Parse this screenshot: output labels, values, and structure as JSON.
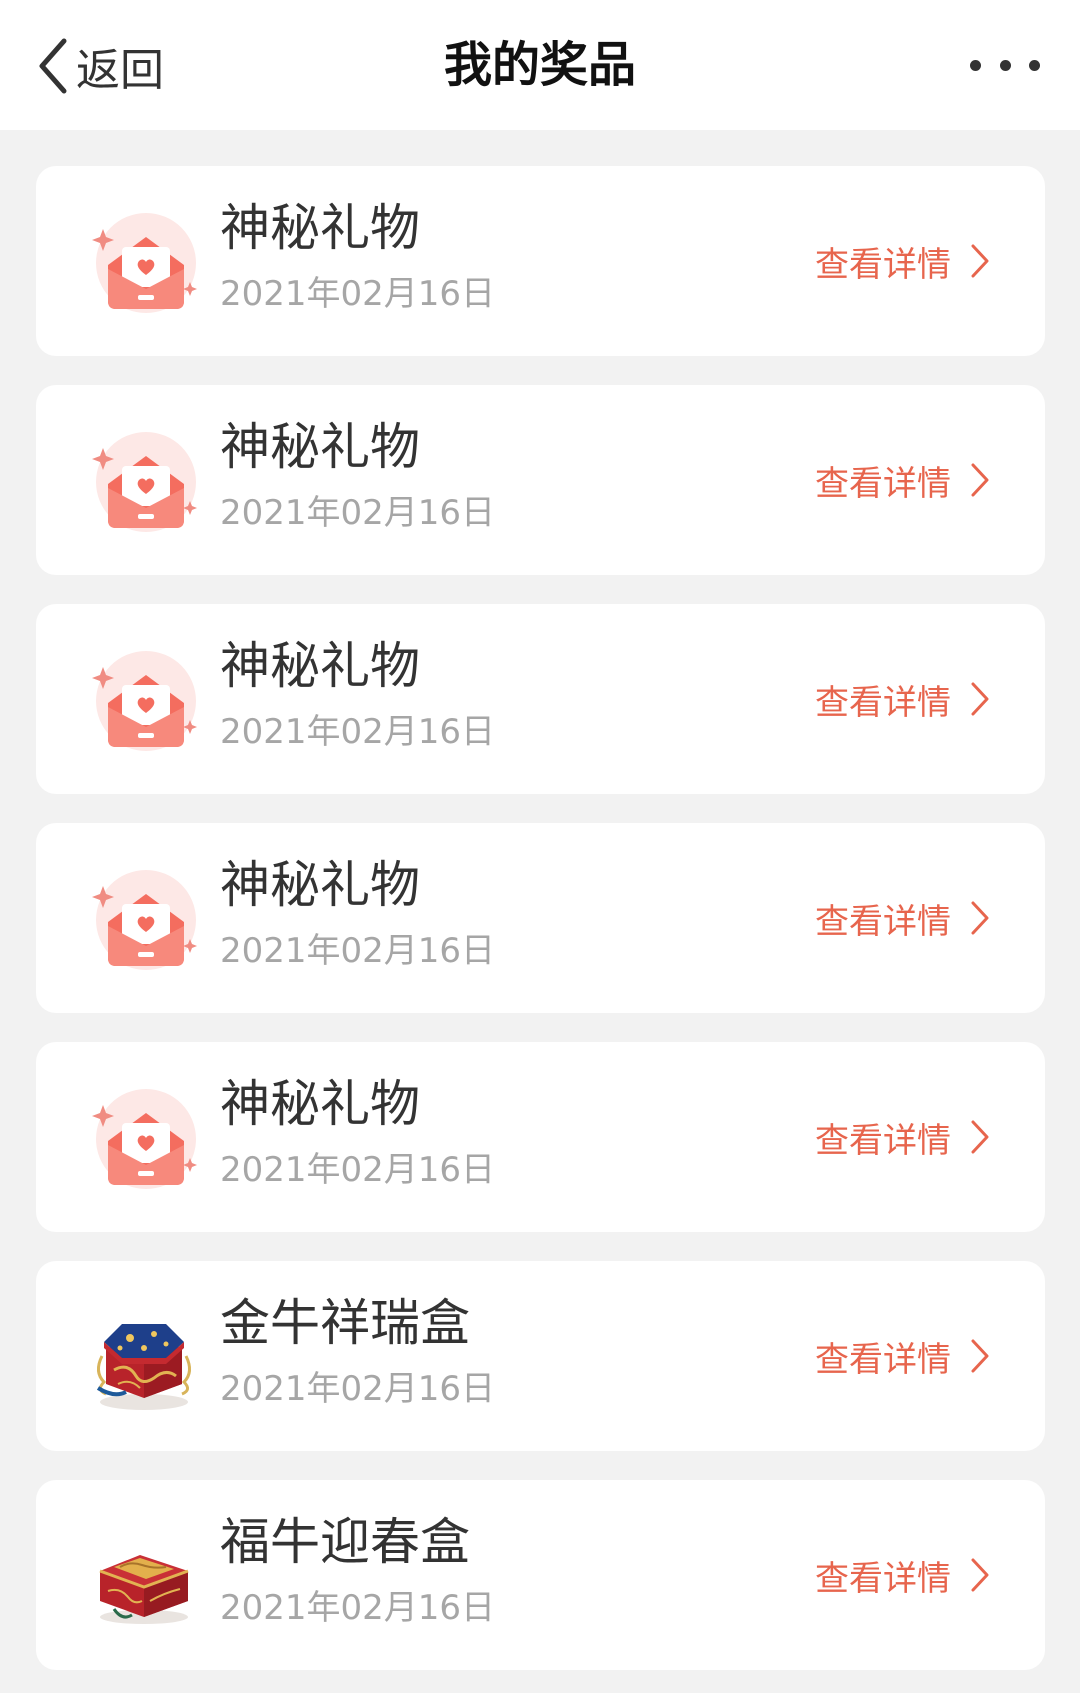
{
  "header": {
    "back_label": "返回",
    "title": "我的奖品"
  },
  "colors": {
    "accent": "#e7654d",
    "date_gray": "#a6a6a6",
    "background": "#f2f2f2"
  },
  "prizes": [
    {
      "name": "神秘礼物",
      "date": "2021年02月16日",
      "detail_label": "查看详情",
      "icon": "envelope-heart-icon"
    },
    {
      "name": "神秘礼物",
      "date": "2021年02月16日",
      "detail_label": "查看详情",
      "icon": "envelope-heart-icon"
    },
    {
      "name": "神秘礼物",
      "date": "2021年02月16日",
      "detail_label": "查看详情",
      "icon": "envelope-heart-icon"
    },
    {
      "name": "神秘礼物",
      "date": "2021年02月16日",
      "detail_label": "查看详情",
      "icon": "envelope-heart-icon"
    },
    {
      "name": "神秘礼物",
      "date": "2021年02月16日",
      "detail_label": "查看详情",
      "icon": "envelope-heart-icon"
    },
    {
      "name": "金牛祥瑞盒",
      "date": "2021年02月16日",
      "detail_label": "查看详情",
      "icon": "octagon-gift-box-icon"
    },
    {
      "name": "福牛迎春盒",
      "date": "2021年02月16日",
      "detail_label": "查看详情",
      "icon": "chest-gift-box-icon"
    }
  ]
}
